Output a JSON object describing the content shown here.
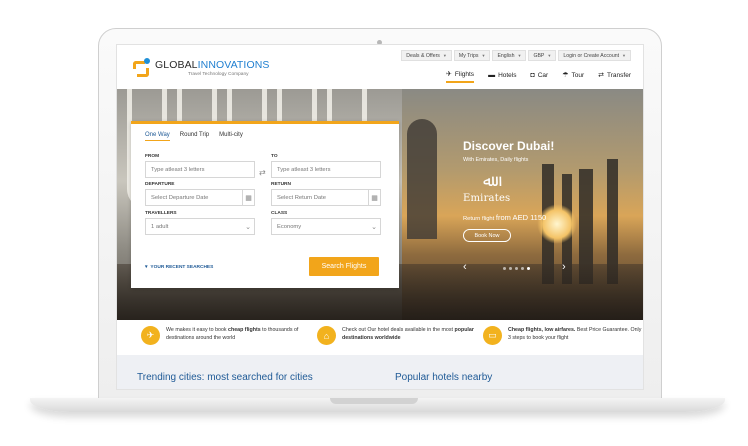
{
  "brand": {
    "name_part1": "GLOBAL",
    "name_part2": "INNOVATIONS",
    "tagline": "Travel Technology Company"
  },
  "topbar": [
    {
      "label": "Deals & Offers"
    },
    {
      "label": "My Trips"
    },
    {
      "label": "English"
    },
    {
      "label": "GBP"
    },
    {
      "label": "Login or Create Account"
    }
  ],
  "nav": [
    {
      "label": "Flights",
      "icon": "plane-icon",
      "active": true
    },
    {
      "label": "Hotels",
      "icon": "bed-icon",
      "active": false
    },
    {
      "label": "Car",
      "icon": "car-icon",
      "active": false
    },
    {
      "label": "Tour",
      "icon": "umbrella-icon",
      "active": false
    },
    {
      "label": "Transfer",
      "icon": "transfer-icon",
      "active": false
    }
  ],
  "search": {
    "tabs": [
      "One Way",
      "Round Trip",
      "Multi-city"
    ],
    "active_tab": "One Way",
    "from_label": "FROM",
    "from_placeholder": "Type atleast 3 letters",
    "to_label": "TO",
    "to_placeholder": "Type atleast 3 letters",
    "departure_label": "DEPARTURE",
    "departure_placeholder": "Select Departure Date",
    "return_label": "RETURN",
    "return_placeholder": "Select Return Date",
    "travellers_label": "TRAVELLERS",
    "travellers_value": "1 adult",
    "class_label": "CLASS",
    "class_value": "Economy",
    "recent_label": "YOUR RECENT SEARCHES",
    "submit_label": "Search Flights"
  },
  "promo": {
    "title": "Discover Dubai!",
    "subtitle": "With Emirates, Daily flights",
    "airline_word": "Emirates",
    "fare_prefix": "Return flight",
    "fare_amount": "from AED 1150",
    "cta": "Book Now",
    "carousel_count": 5,
    "carousel_active": 4
  },
  "features": [
    {
      "pre": "We makes it easy to book ",
      "bold": "cheap flights",
      "post": " to thousands of destinations around the world",
      "icon": "plane-icon"
    },
    {
      "pre": "Check out Our hotel deals available in the most ",
      "bold": "popular destinations worldwide",
      "post": "",
      "icon": "tag-icon"
    },
    {
      "pre": "",
      "bold": "Cheap flights, low airfares.",
      "post": " Best Price Guarantee. Only 3 steps to book your flight",
      "icon": "ticket-icon"
    }
  ],
  "sections": {
    "trending": "Trending cities: most searched for cities",
    "hotels": "Popular hotels nearby"
  },
  "colors": {
    "accent": "#f2a51a",
    "link": "#1f5a96"
  }
}
